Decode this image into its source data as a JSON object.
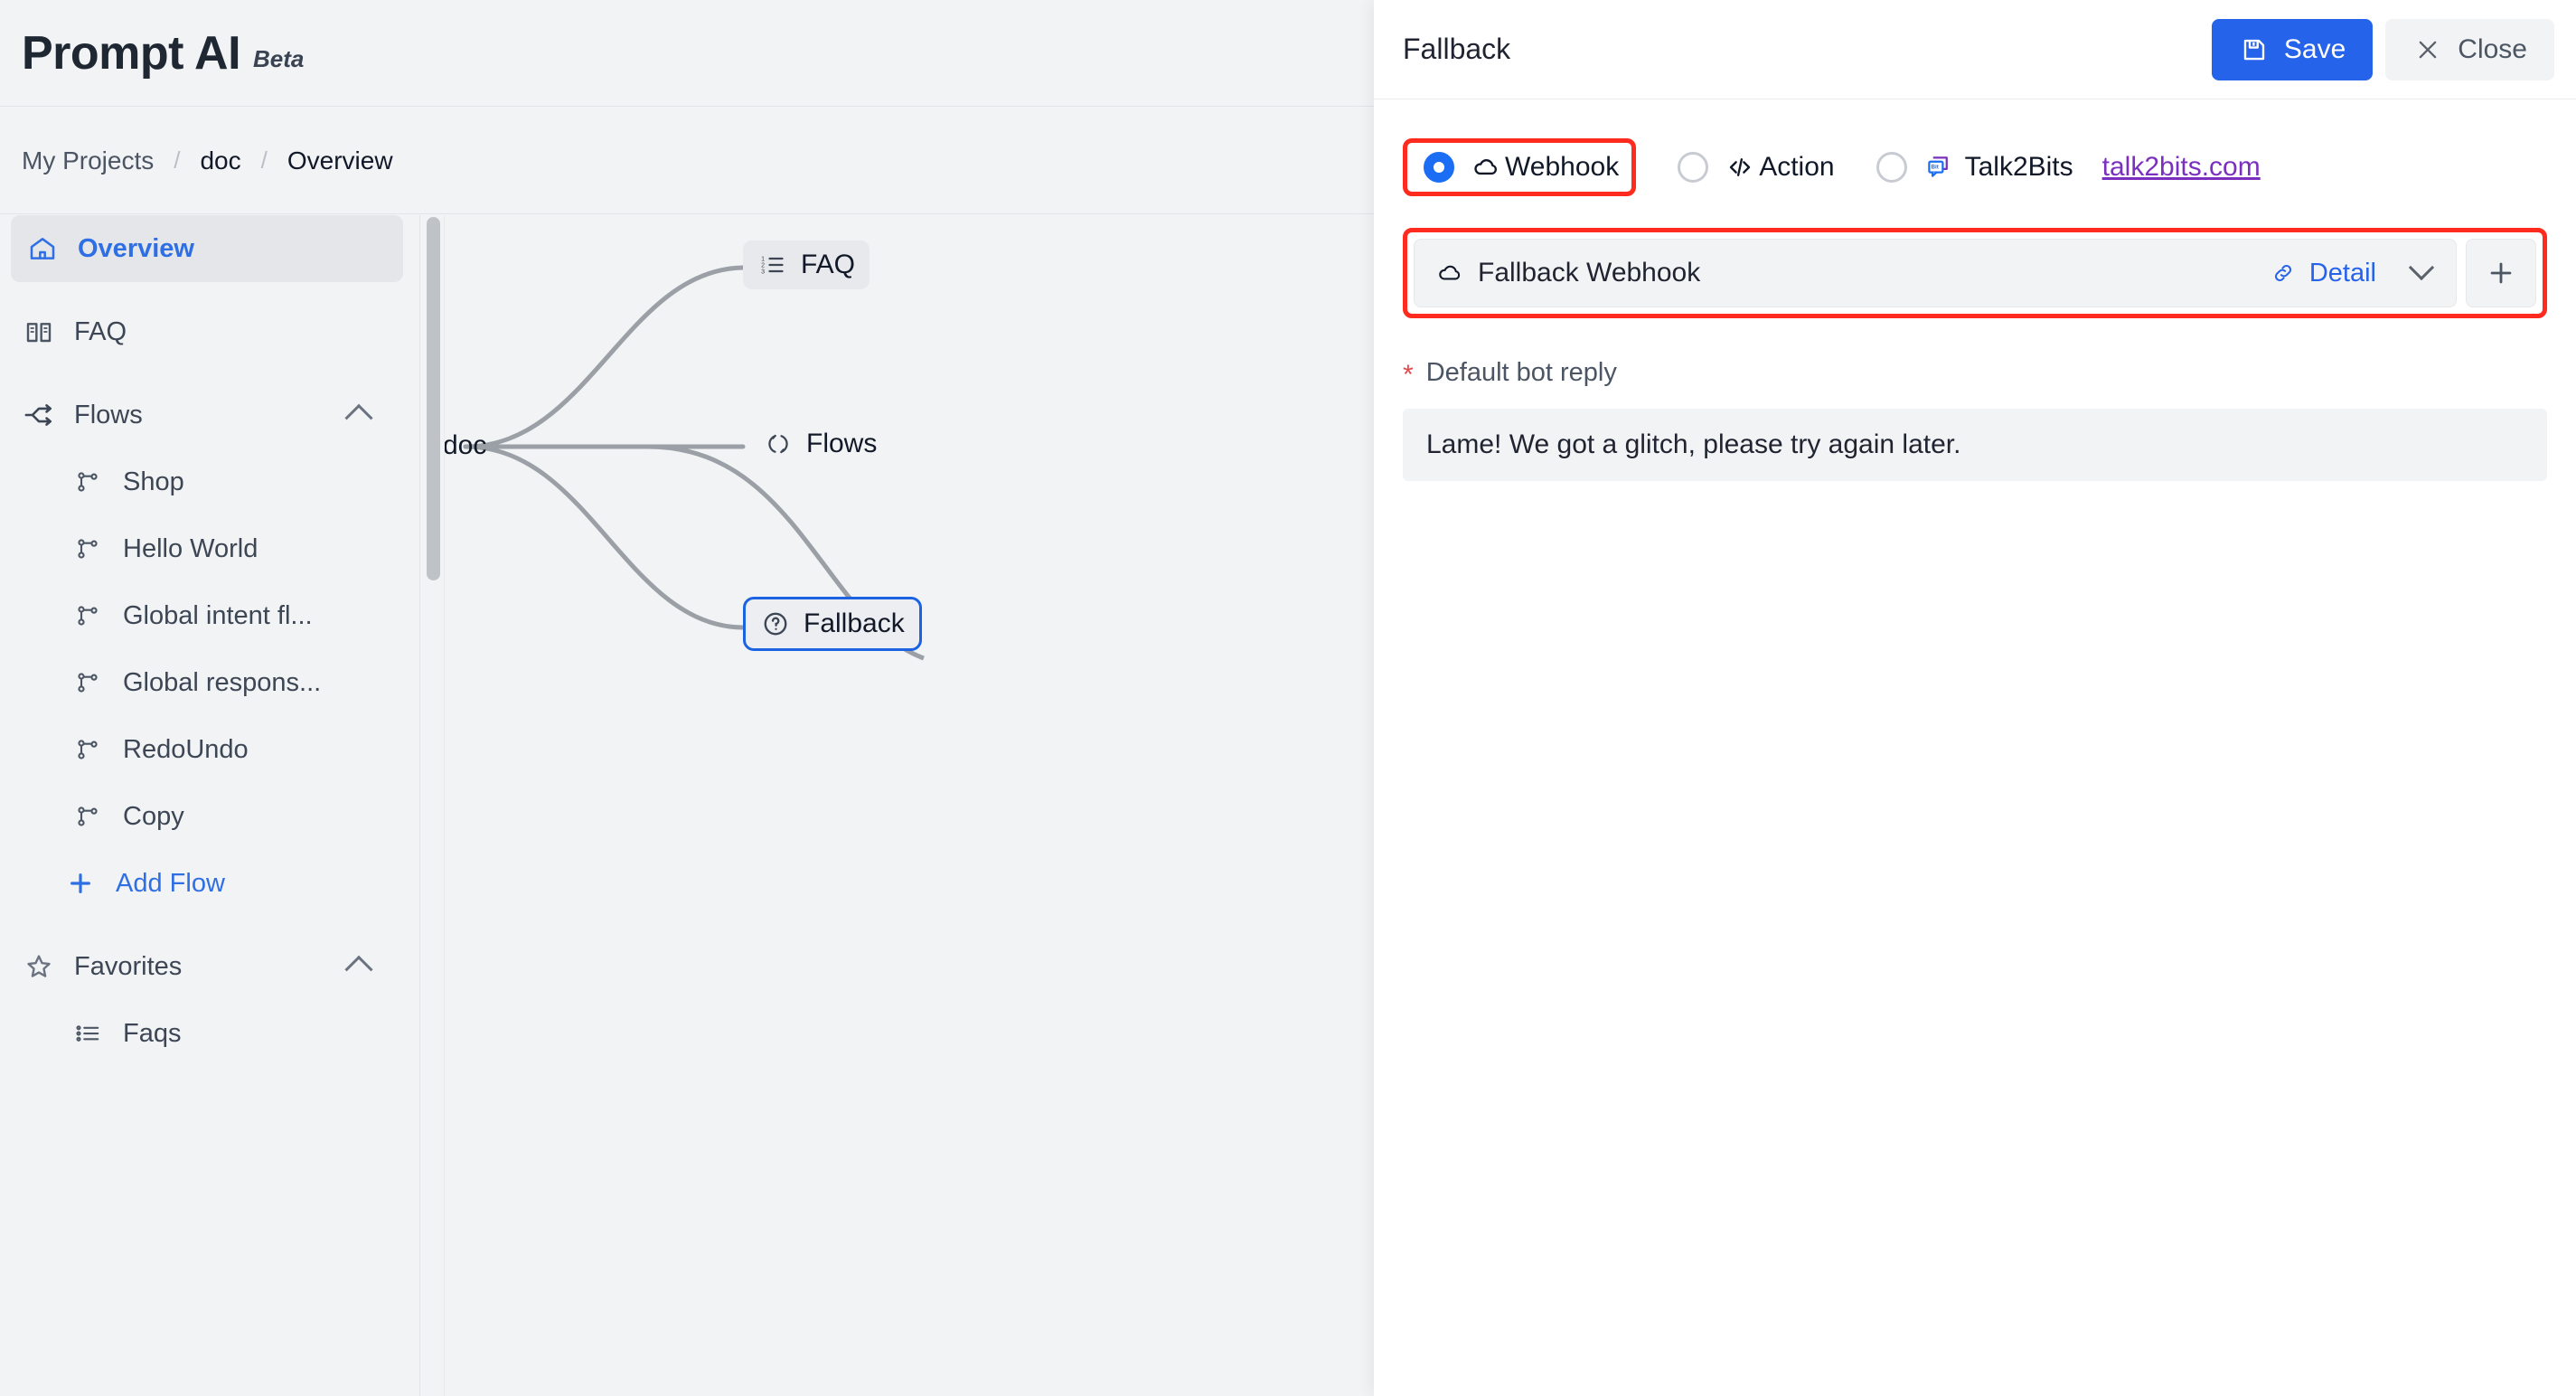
{
  "app": {
    "brand": "Prompt AI",
    "brand_badge": "Beta"
  },
  "breadcrumb": {
    "items": [
      "My Projects",
      "doc",
      "Overview"
    ],
    "separator": "/"
  },
  "sidebar": {
    "items": [
      {
        "label": "Overview",
        "icon": "home-icon",
        "active": true
      },
      {
        "label": "FAQ",
        "icon": "book-icon",
        "active": false
      },
      {
        "label": "Flows",
        "icon": "flow-icon",
        "group": true,
        "expanded": true
      },
      {
        "label": "Shop",
        "icon": "branch-icon",
        "child": true
      },
      {
        "label": "Hello World",
        "icon": "branch-icon",
        "child": true
      },
      {
        "label": "Global intent fl...",
        "icon": "branch-icon",
        "child": true
      },
      {
        "label": "Global respons...",
        "icon": "branch-icon",
        "child": true
      },
      {
        "label": "RedoUndo",
        "icon": "branch-icon",
        "child": true
      },
      {
        "label": "Copy",
        "icon": "branch-icon",
        "child": true
      },
      {
        "label": "Add Flow",
        "icon": "plus-icon",
        "add": true
      },
      {
        "label": "Favorites",
        "icon": "star-icon",
        "group": true,
        "expanded": true
      },
      {
        "label": "Faqs",
        "icon": "list-icon",
        "child": true
      }
    ]
  },
  "canvas": {
    "nodes": {
      "root": {
        "label": "doc",
        "icon": "grid-icon"
      },
      "faq": {
        "label": "FAQ",
        "icon": "numbered-list-icon"
      },
      "flows": {
        "label": "Flows",
        "icon": "refresh-icon"
      },
      "fallback": {
        "label": "Fallback",
        "icon": "question-circle-icon",
        "selected": true
      }
    }
  },
  "panel": {
    "title": "Fallback",
    "save_label": "Save",
    "close_label": "Close",
    "options": [
      {
        "label": "Webhook",
        "icon": "cloud-icon",
        "selected": true,
        "highlighted": true
      },
      {
        "label": "Action",
        "icon": "code-icon",
        "selected": false
      },
      {
        "label": "Talk2Bits",
        "icon": "talk2bits-icon",
        "selected": false,
        "link": "talk2bits.com"
      }
    ],
    "webhook_select": {
      "value": "Fallback Webhook",
      "icon": "cloud-icon",
      "detail_label": "Detail",
      "add_label": "+"
    },
    "default_reply": {
      "label": "Default bot reply",
      "required_marker": "*",
      "value": "Lame! We got a glitch, please try again later."
    }
  },
  "colors": {
    "accent": "#2563eb",
    "highlight": "#ff2b1f",
    "link_visited": "#7b2fbe",
    "required": "#e5484d"
  }
}
